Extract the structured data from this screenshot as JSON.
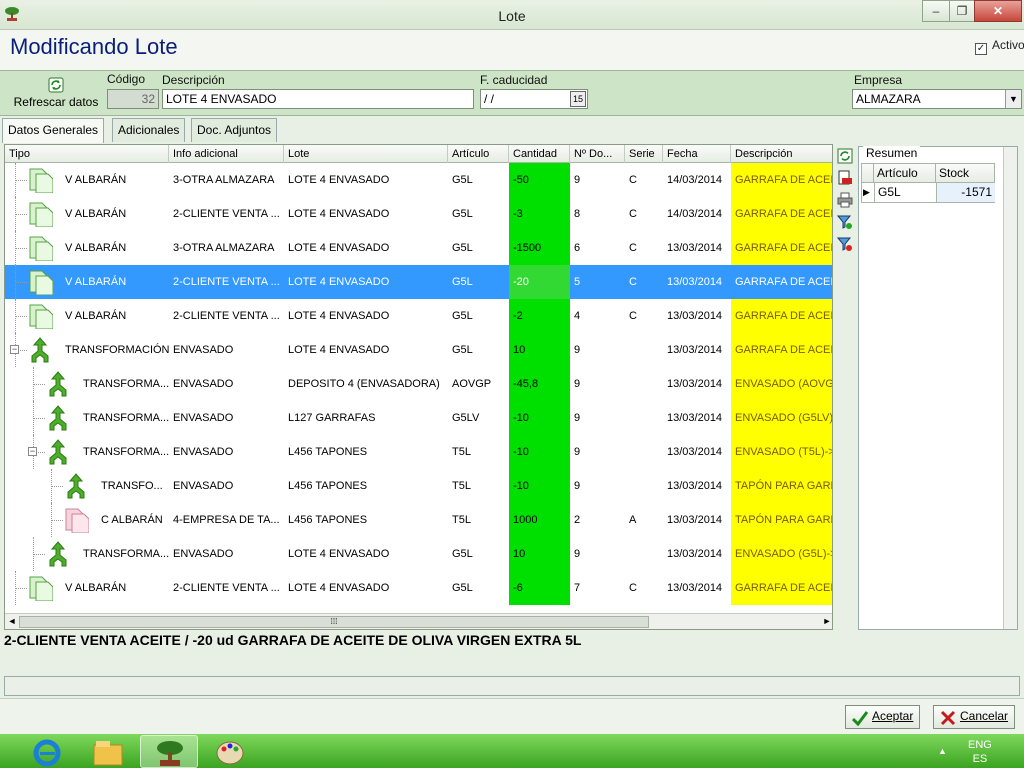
{
  "window": {
    "title": "Lote",
    "min": "‒",
    "max": "❐",
    "close": "✕"
  },
  "header": {
    "title": "Modificando Lote",
    "activo_label": "Activo",
    "activo_checked": "✓"
  },
  "toolbar": {
    "refresh_label": "Refrescar datos",
    "codigo_label": "Código",
    "codigo_value": "32",
    "descripcion_label": "Descripción",
    "descripcion_value": "LOTE 4 ENVASADO",
    "caducidad_label": "F. caducidad",
    "caducidad_value": " / /",
    "calendar_glyph": "15",
    "empresa_label": "Empresa",
    "empresa_value": "ALMAZARA",
    "dropdown_glyph": "▼"
  },
  "tabs": [
    "Datos Generales",
    "Adicionales",
    "Doc. Adjuntos"
  ],
  "grid": {
    "columns": [
      "Tipo",
      "Info adicional",
      "Lote",
      "Artículo",
      "Cantidad",
      "Nº Do...",
      "Serie",
      "Fecha",
      "Descripción"
    ],
    "rows": [
      {
        "tipo": "V ALBARÁN",
        "info": "3-OTRA ALMAZARA",
        "lote": "LOTE 4 ENVASADO",
        "articulo": "G5L",
        "cantidad": "-50",
        "ndoc": "9",
        "serie": "C",
        "fecha": "14/03/2014",
        "descripcion": "GARRAFA DE ACEITE",
        "icon": "doc-green-icon",
        "level": 0
      },
      {
        "tipo": "V ALBARÁN",
        "info": "2-CLIENTE VENTA ...",
        "lote": "LOTE 4 ENVASADO",
        "articulo": "G5L",
        "cantidad": "-3",
        "ndoc": "8",
        "serie": "C",
        "fecha": "14/03/2014",
        "descripcion": "GARRAFA DE ACEITE",
        "icon": "doc-green-icon",
        "level": 0
      },
      {
        "tipo": "V ALBARÁN",
        "info": "3-OTRA ALMAZARA",
        "lote": "LOTE 4 ENVASADO",
        "articulo": "G5L",
        "cantidad": "-1500",
        "ndoc": "6",
        "serie": "C",
        "fecha": "13/03/2014",
        "descripcion": "GARRAFA DE ACEITE",
        "icon": "doc-green-icon",
        "level": 0
      },
      {
        "tipo": "V ALBARÁN",
        "info": "2-CLIENTE VENTA ...",
        "lote": "LOTE 4 ENVASADO",
        "articulo": "G5L",
        "cantidad": "-20",
        "ndoc": "5",
        "serie": "C",
        "fecha": "13/03/2014",
        "descripcion": "GARRAFA DE ACEITE",
        "icon": "doc-green-icon",
        "level": 0,
        "selected": true
      },
      {
        "tipo": "V ALBARÁN",
        "info": "2-CLIENTE VENTA ...",
        "lote": "LOTE 4 ENVASADO",
        "articulo": "G5L",
        "cantidad": "-2",
        "ndoc": "4",
        "serie": "C",
        "fecha": "13/03/2014",
        "descripcion": "GARRAFA DE ACEITE",
        "icon": "doc-green-icon",
        "level": 0
      },
      {
        "tipo": "TRANSFORMACIÓN",
        "info": "ENVASADO",
        "lote": "LOTE 4 ENVASADO",
        "articulo": "G5L",
        "cantidad": "10",
        "ndoc": "9",
        "serie": "",
        "fecha": "13/03/2014",
        "descripcion": "GARRAFA DE ACEITE",
        "icon": "merge-arrow-icon",
        "level": 0,
        "expander": "−"
      },
      {
        "tipo": "TRANSFORMA...",
        "info": "ENVASADO",
        "lote": "DEPOSITO 4 (ENVASADORA)",
        "articulo": "AOVGP",
        "cantidad": "-45,8",
        "ndoc": "9",
        "serie": "",
        "fecha": "13/03/2014",
        "descripcion": "ENVASADO (AOVG",
        "icon": "merge-arrow-icon",
        "level": 1
      },
      {
        "tipo": "TRANSFORMA...",
        "info": "ENVASADO",
        "lote": "L127 GARRAFAS",
        "articulo": "G5LV",
        "cantidad": "-10",
        "ndoc": "9",
        "serie": "",
        "fecha": "13/03/2014",
        "descripcion": "ENVASADO (G5LV)",
        "icon": "merge-arrow-icon",
        "level": 1
      },
      {
        "tipo": "TRANSFORMA...",
        "info": "ENVASADO",
        "lote": "L456 TAPONES",
        "articulo": "T5L",
        "cantidad": "-10",
        "ndoc": "9",
        "serie": "",
        "fecha": "13/03/2014",
        "descripcion": "ENVASADO (T5L)->",
        "icon": "merge-arrow-icon",
        "level": 1,
        "expander": "−"
      },
      {
        "tipo": "TRANSFO...",
        "info": "ENVASADO",
        "lote": "L456 TAPONES",
        "articulo": "T5L",
        "cantidad": "-10",
        "ndoc": "9",
        "serie": "",
        "fecha": "13/03/2014",
        "descripcion": "TAPÓN PARA GARR",
        "icon": "merge-arrow-icon",
        "level": 2
      },
      {
        "tipo": "C ALBARÁN",
        "info": "4-EMPRESA DE TA...",
        "lote": "L456 TAPONES",
        "articulo": "T5L",
        "cantidad": "1000",
        "ndoc": "2",
        "serie": "A",
        "fecha": "13/03/2014",
        "descripcion": "TAPÓN PARA GARR",
        "icon": "doc-pink-icon",
        "level": 2
      },
      {
        "tipo": "TRANSFORMA...",
        "info": "ENVASADO",
        "lote": "LOTE 4 ENVASADO",
        "articulo": "G5L",
        "cantidad": "10",
        "ndoc": "9",
        "serie": "",
        "fecha": "13/03/2014",
        "descripcion": "ENVASADO (G5L)->",
        "icon": "merge-arrow-icon",
        "level": 1
      },
      {
        "tipo": "V ALBARÁN",
        "info": "2-CLIENTE VENTA ...",
        "lote": "LOTE 4 ENVASADO",
        "articulo": "G5L",
        "cantidad": "-6",
        "ndoc": "7",
        "serie": "C",
        "fecha": "13/03/2014",
        "descripcion": "GARRAFA DE ACEITE",
        "icon": "doc-green-icon",
        "level": 0
      }
    ],
    "scroll_grip": "⁞⁞⁞",
    "scroll_left": "◄",
    "scroll_right": "►"
  },
  "resumen": {
    "title": "Resumen",
    "columns": [
      "Artículo",
      "Stock"
    ],
    "rows": [
      {
        "articulo": "G5L",
        "stock": "-1571"
      }
    ],
    "row_pointer": "▶"
  },
  "detail_text": "2-CLIENTE VENTA ACEITE / -20 ud GARRAFA DE ACEITE DE OLIVA VIRGEN EXTRA 5L",
  "footer": {
    "accept_label": "Aceptar",
    "cancel_label": "Cancelar"
  },
  "taskbar": {
    "lang_top": "ENG",
    "lang_bottom": "ES",
    "tray_arrow": "▲"
  },
  "colors": {
    "cantidad": "#00e000",
    "descripcion": "#ffff00",
    "selected": "#3399ff",
    "title": "#0a1f7a"
  }
}
